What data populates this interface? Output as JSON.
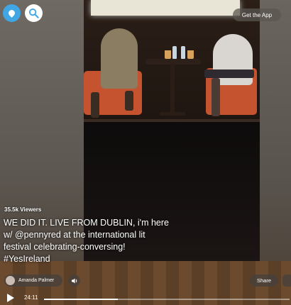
{
  "header": {
    "get_app_label": "Get the App"
  },
  "stream": {
    "viewers": "35.5k Viewers",
    "caption": "WE DID IT. LIVE FROM DUBLIN, i'm here w/ @pennyred at the international lit festival celebrating-conversing! #YesIreland",
    "broadcaster": "Amanda Palmer"
  },
  "controls": {
    "share_label": "Share",
    "elapsed": "24:11",
    "progress_fraction": 0.3
  },
  "icons": {
    "logo": "periscope-pin-icon",
    "search": "search-icon",
    "volume": "volume-icon",
    "play": "play-icon"
  },
  "colors": {
    "brand": "#40a6e4"
  }
}
